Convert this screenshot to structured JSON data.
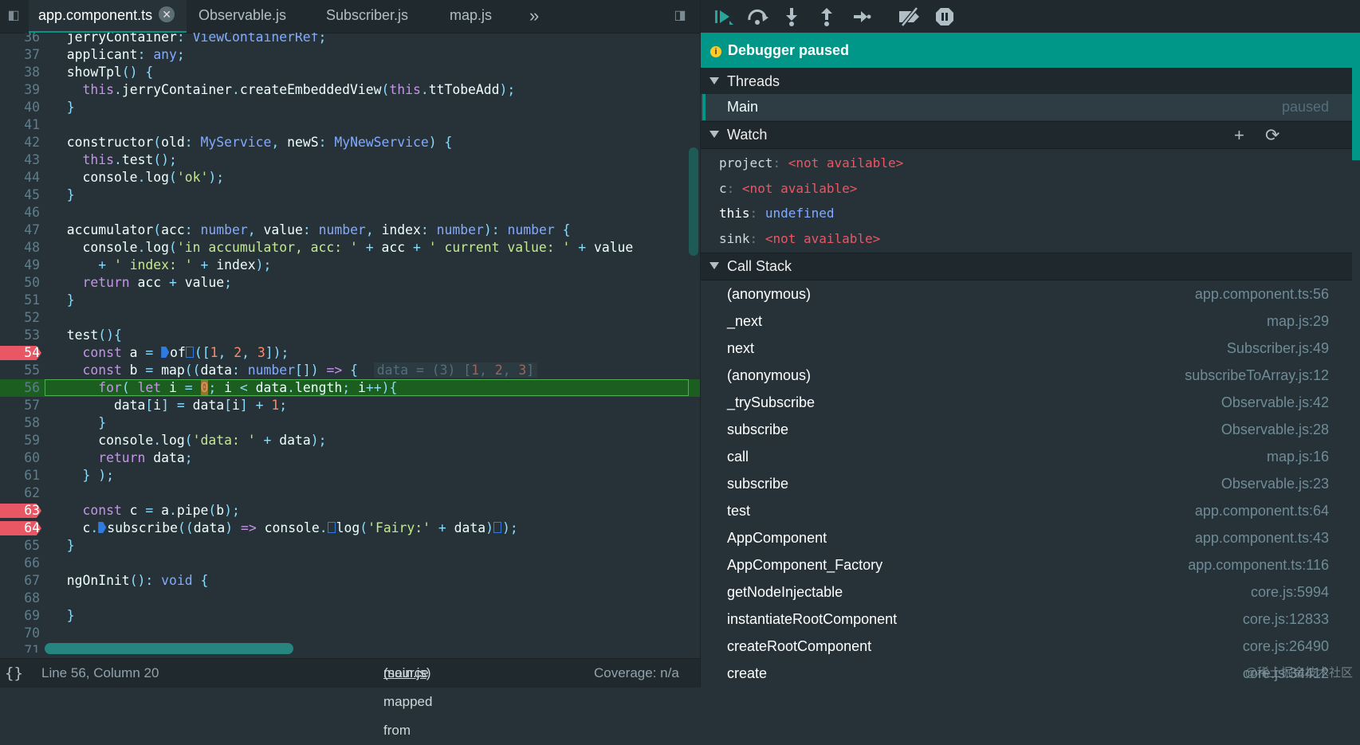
{
  "editor": {
    "tabs": [
      {
        "label": "app.component.ts",
        "close": "✕"
      },
      {
        "label": "Observable.js"
      },
      {
        "label": "Subscriber.js"
      },
      {
        "label": "map.js"
      }
    ],
    "overflow_icon": "»",
    "status": {
      "braces": "{}",
      "position": "Line 56, Column 20",
      "source_prefix": "(source mapped from ",
      "source_link": "main.js",
      "source_suffix": ")",
      "coverage": "Coverage: n/a"
    }
  },
  "lines": {
    "l36": "36",
    "l37": "37",
    "l38": "38",
    "l39": "39",
    "l40": "40",
    "l41": "41",
    "l42": "42",
    "l43": "43",
    "l44": "44",
    "l45": "45",
    "l46": "46",
    "l47": "47",
    "l48": "48",
    "l49": "49",
    "l50": "50",
    "l51": "51",
    "l52": "52",
    "l53": "53",
    "l54": "54",
    "l55": "55",
    "l56": "56",
    "l57": "57",
    "l58": "58",
    "l59": "59",
    "l60": "60",
    "l61": "61",
    "l62": "62",
    "l63": "63",
    "l64": "64",
    "l65": "65",
    "l66": "66",
    "l67": "67",
    "l68": "68",
    "l69": "69",
    "l70": "70",
    "l71": "71"
  },
  "debugger": {
    "banner": "Debugger paused",
    "info_icon": "i",
    "threads": {
      "title": "Threads",
      "items": [
        {
          "name": "Main",
          "state": "paused"
        }
      ]
    },
    "watch": {
      "title": "Watch",
      "add": "+",
      "refresh": "⟳",
      "items": [
        {
          "name": "project",
          "sep": ":",
          "value": "<not available>"
        },
        {
          "name": "c",
          "sep": ":",
          "value": "<not available>"
        },
        {
          "name": "this",
          "sep": ":",
          "value": "undefined"
        },
        {
          "name": "sink",
          "sep": ":",
          "value": "<not available>"
        }
      ]
    },
    "callstack": {
      "title": "Call Stack",
      "frames": [
        {
          "fn": "(anonymous)",
          "loc": "app.component.ts:56"
        },
        {
          "fn": "_next",
          "loc": "map.js:29"
        },
        {
          "fn": "next",
          "loc": "Subscriber.js:49"
        },
        {
          "fn": "(anonymous)",
          "loc": "subscribeToArray.js:12"
        },
        {
          "fn": "_trySubscribe",
          "loc": "Observable.js:42"
        },
        {
          "fn": "subscribe",
          "loc": "Observable.js:28"
        },
        {
          "fn": "call",
          "loc": "map.js:16"
        },
        {
          "fn": "subscribe",
          "loc": "Observable.js:23"
        },
        {
          "fn": "test",
          "loc": "app.component.ts:64"
        },
        {
          "fn": "AppComponent",
          "loc": "app.component.ts:43"
        },
        {
          "fn": "AppComponent_Factory",
          "loc": "app.component.ts:116"
        },
        {
          "fn": "getNodeInjectable",
          "loc": "core.js:5994"
        },
        {
          "fn": "instantiateRootComponent",
          "loc": "core.js:12833"
        },
        {
          "fn": "createRootComponent",
          "loc": "core.js:26490"
        },
        {
          "fn": "create",
          "loc": "core.js:34412"
        }
      ]
    }
  },
  "watermark": "@稀土掘金技术社区"
}
